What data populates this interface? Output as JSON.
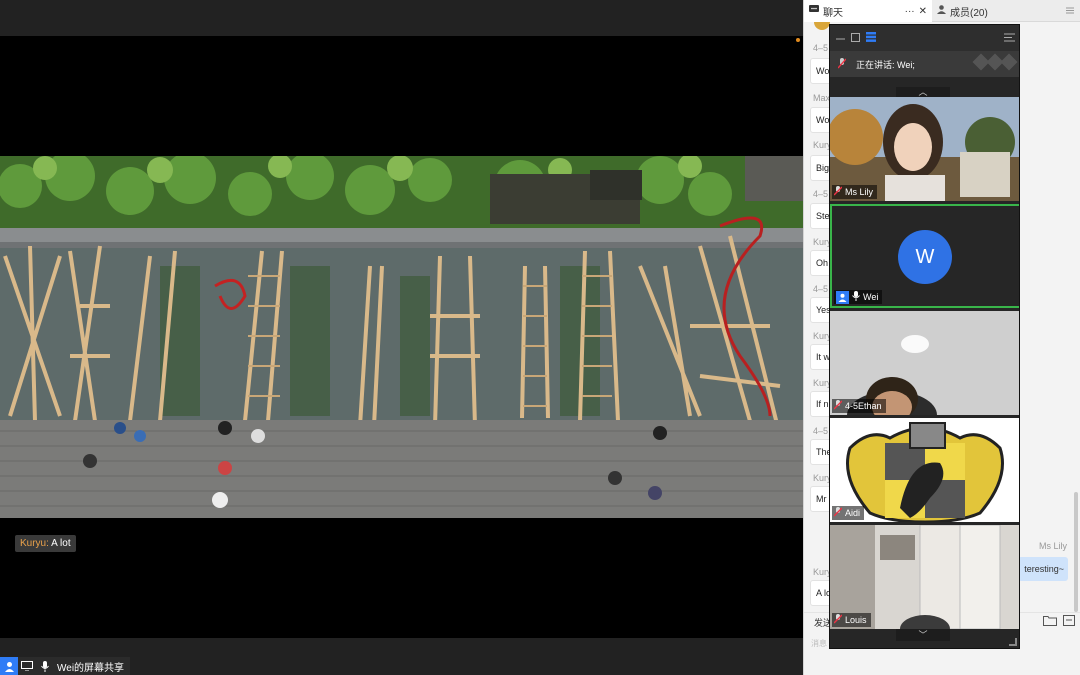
{
  "caption": {
    "speaker": "Kuryu:",
    "text": " A lot"
  },
  "share_label": {
    "text": "Wei的屏幕共享"
  },
  "chat": {
    "tab_chat": "聊天",
    "tab_more": "···",
    "tab_close": "✕",
    "tab_members": "成员(20)",
    "messages": [
      {
        "name": "4–5…",
        "text": "Wo"
      },
      {
        "name": "Max…",
        "text": "Wo"
      },
      {
        "name": "Kury…",
        "text": "Big"
      },
      {
        "name": "4–5…",
        "text": "Ste"
      },
      {
        "name": "Kury…",
        "text": "Oh"
      },
      {
        "name": "4–5…",
        "text": "Yes"
      },
      {
        "name": "Kury…",
        "text": "It w"
      },
      {
        "name": "Kury…",
        "text": "If n"
      },
      {
        "name": "4–5…",
        "text": "The"
      },
      {
        "name": "Kury…",
        "text": "Mr"
      },
      {
        "name": "Kury…",
        "text": "A lo"
      }
    ],
    "right_name": "Ms Lily",
    "right_text": "teresting~",
    "send_label": "发送",
    "send_hint": "消息"
  },
  "gallery": {
    "speaking_text": "正在讲话: Wei;",
    "tiles": [
      {
        "name": "Ms Lily"
      },
      {
        "name": "Wei",
        "avatar": "W"
      },
      {
        "name": "4-5Ethan"
      },
      {
        "name": "Aidi"
      },
      {
        "name": "Louis"
      }
    ]
  },
  "colors": {
    "accent": "#2f7cf6",
    "active_border": "#39b54a",
    "caption_name": "#e9a14a"
  }
}
